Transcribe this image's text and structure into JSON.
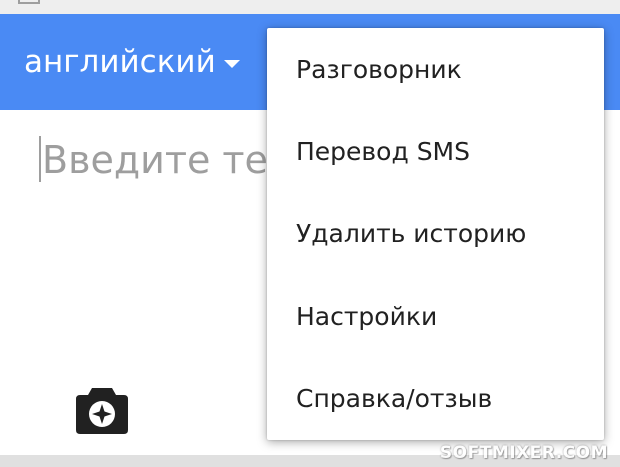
{
  "app_bar": {
    "source_language": "английский"
  },
  "input": {
    "placeholder": "Введите текст"
  },
  "icons": {
    "dropdown": "dropdown-arrow-icon",
    "camera": "camera-icon"
  },
  "menu": {
    "items": [
      {
        "label": "Разговорник"
      },
      {
        "label": "Перевод SMS"
      },
      {
        "label": "Удалить историю"
      },
      {
        "label": "Настройки"
      },
      {
        "label": "Справка/отзыв"
      }
    ]
  },
  "watermark": "SOFTMIXER.COM",
  "colors": {
    "app_bar": "#4a8af4",
    "menu_background": "#ffffff",
    "menu_text": "#212121",
    "placeholder": "#9e9e9e",
    "icon": "#212121"
  }
}
